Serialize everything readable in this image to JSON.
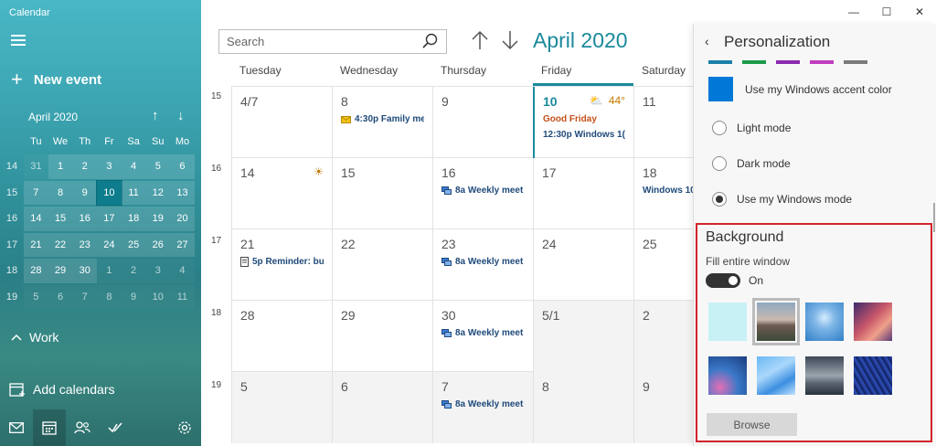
{
  "sidebar": {
    "app_title": "Calendar",
    "new_event": "New event",
    "mini_month": "April 2020",
    "weekdays": [
      "Tu",
      "We",
      "Th",
      "Fr",
      "Sa",
      "Su",
      "Mo"
    ],
    "rows": [
      {
        "week": "14",
        "days": [
          {
            "d": "31",
            "t": "oth"
          },
          {
            "d": "1",
            "t": "cur"
          },
          {
            "d": "2",
            "t": "cur"
          },
          {
            "d": "3",
            "t": "cur"
          },
          {
            "d": "4",
            "t": "cur"
          },
          {
            "d": "5",
            "t": "cur"
          },
          {
            "d": "6",
            "t": "cur"
          }
        ]
      },
      {
        "week": "15",
        "days": [
          {
            "d": "7",
            "t": "cur"
          },
          {
            "d": "8",
            "t": "cur"
          },
          {
            "d": "9",
            "t": "cur"
          },
          {
            "d": "10",
            "t": "today"
          },
          {
            "d": "11",
            "t": "cur"
          },
          {
            "d": "12",
            "t": "cur"
          },
          {
            "d": "13",
            "t": "cur"
          }
        ]
      },
      {
        "week": "16",
        "days": [
          {
            "d": "14",
            "t": "cur"
          },
          {
            "d": "15",
            "t": "cur"
          },
          {
            "d": "16",
            "t": "cur"
          },
          {
            "d": "17",
            "t": "cur"
          },
          {
            "d": "18",
            "t": "cur"
          },
          {
            "d": "19",
            "t": "cur"
          },
          {
            "d": "20",
            "t": "cur"
          }
        ]
      },
      {
        "week": "17",
        "days": [
          {
            "d": "21",
            "t": "cur"
          },
          {
            "d": "22",
            "t": "cur"
          },
          {
            "d": "23",
            "t": "cur"
          },
          {
            "d": "24",
            "t": "cur"
          },
          {
            "d": "25",
            "t": "cur"
          },
          {
            "d": "26",
            "t": "cur"
          },
          {
            "d": "27",
            "t": "cur"
          }
        ]
      },
      {
        "week": "18",
        "days": [
          {
            "d": "28",
            "t": "cur"
          },
          {
            "d": "29",
            "t": "cur"
          },
          {
            "d": "30",
            "t": "cur"
          },
          {
            "d": "1",
            "t": "oth"
          },
          {
            "d": "2",
            "t": "oth"
          },
          {
            "d": "3",
            "t": "oth"
          },
          {
            "d": "4",
            "t": "oth"
          }
        ]
      },
      {
        "week": "19",
        "days": [
          {
            "d": "5",
            "t": "oth"
          },
          {
            "d": "6",
            "t": "oth"
          },
          {
            "d": "7",
            "t": "oth"
          },
          {
            "d": "8",
            "t": "oth"
          },
          {
            "d": "9",
            "t": "oth"
          },
          {
            "d": "10",
            "t": "oth"
          },
          {
            "d": "11",
            "t": "oth"
          }
        ]
      }
    ],
    "work_label": "Work",
    "add_calendars": "Add calendars"
  },
  "main": {
    "search_placeholder": "Search",
    "month_title": "April 2020",
    "columns": [
      "Tuesday",
      "Wednesday",
      "Thursday",
      "Friday",
      "Saturday"
    ],
    "week_numbers": [
      "15",
      "16",
      "17",
      "18",
      "19"
    ],
    "weeks": [
      [
        {
          "day": "4/7",
          "events": []
        },
        {
          "day": "8",
          "events": [
            {
              "icon": "envelope",
              "text": "4:30p Family me"
            }
          ]
        },
        {
          "day": "9",
          "events": []
        },
        {
          "day": "10",
          "today": true,
          "weather": "44°",
          "events": [
            {
              "text": "Good Friday",
              "red": true
            },
            {
              "text": "12:30p  Windows 1("
            }
          ]
        },
        {
          "day": "11",
          "events": []
        }
      ],
      [
        {
          "day": "14",
          "sun": true,
          "events": []
        },
        {
          "day": "15",
          "events": []
        },
        {
          "day": "16",
          "events": [
            {
              "icon": "chat",
              "text": "8a Weekly meet"
            }
          ]
        },
        {
          "day": "17",
          "events": []
        },
        {
          "day": "18",
          "events": [
            {
              "text": "Windows 10"
            }
          ]
        }
      ],
      [
        {
          "day": "21",
          "events": [
            {
              "icon": "doc",
              "text": "5p Reminder: bu"
            }
          ]
        },
        {
          "day": "22",
          "events": []
        },
        {
          "day": "23",
          "events": [
            {
              "icon": "chat",
              "text": "8a Weekly meet"
            }
          ]
        },
        {
          "day": "24",
          "events": []
        },
        {
          "day": "25",
          "events": []
        }
      ],
      [
        {
          "day": "28",
          "events": []
        },
        {
          "day": "29",
          "events": []
        },
        {
          "day": "30",
          "events": [
            {
              "icon": "chat",
              "text": "8a Weekly meet"
            }
          ]
        },
        {
          "day": "5/1",
          "shade": true,
          "events": []
        },
        {
          "day": "2",
          "shade": true,
          "events": []
        }
      ],
      [
        {
          "day": "5",
          "shade": true,
          "events": []
        },
        {
          "day": "6",
          "shade": true,
          "events": []
        },
        {
          "day": "7",
          "shade": true,
          "events": [
            {
              "icon": "chat",
              "text": "8a Weekly meet"
            }
          ]
        },
        {
          "day": "8",
          "shade": true,
          "events": []
        },
        {
          "day": "9",
          "shade": true,
          "events": []
        }
      ]
    ]
  },
  "panel": {
    "title": "Personalization",
    "swatch_colors": [
      "#1a7fa8",
      "#1c9a4a",
      "#8a2ab0",
      "#c03cc0",
      "#7a7a7a"
    ],
    "accent_label": "Use my Windows accent color",
    "accent_color": "#0078d7",
    "modes": [
      {
        "label": "Light mode",
        "on": false
      },
      {
        "label": "Dark mode",
        "on": false
      },
      {
        "label": "Use my Windows mode",
        "on": true
      }
    ],
    "background_heading": "Background",
    "fill_label": "Fill entire window",
    "toggle_state": "On",
    "browse": "Browse"
  },
  "colors": {
    "accent": "#1a8a9c",
    "highlight_box": "#d2232a"
  }
}
